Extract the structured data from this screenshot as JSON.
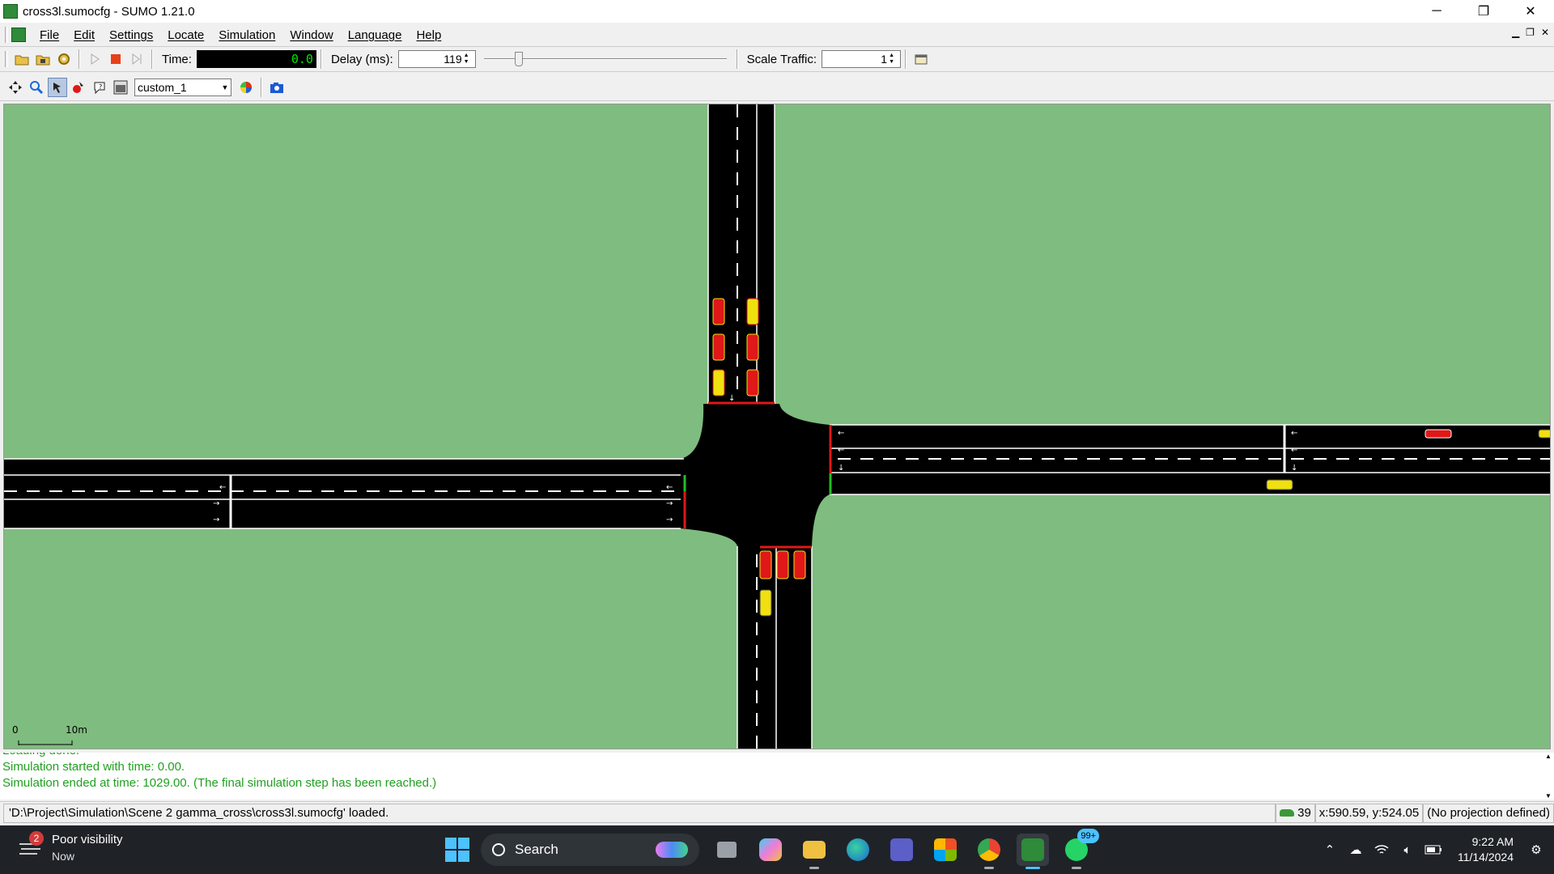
{
  "window": {
    "title": "cross3l.sumocfg - SUMO 1.21.0",
    "controls": [
      "─",
      "❐",
      "✕"
    ]
  },
  "menu": {
    "items": [
      "File",
      "Edit",
      "Settings",
      "Locate",
      "Simulation",
      "Window",
      "Language",
      "Help"
    ]
  },
  "toolbar": {
    "time_label": "Time:",
    "time_value": "0.0",
    "delay_label": "Delay (ms):",
    "delay_value": "119",
    "scale_label": "Scale Traffic:",
    "scale_value": "1"
  },
  "view_toolbar": {
    "scheme": "custom_1"
  },
  "canvas": {
    "scale_bar_start": "0",
    "scale_bar_end": "10m"
  },
  "messages": {
    "lines": [
      "Loading done.",
      "Simulation started with time: 0.00.",
      "Simulation ended at time: 1029.00. (The final simulation step has been reached.)"
    ]
  },
  "status": {
    "text": "'D:\\Project\\Simulation\\Scene 2 gamma_cross\\cross3l.sumocfg' loaded.",
    "vehicle_count": "39",
    "coords": "x:590.59, y:524.05",
    "projection": "(No projection defined)"
  },
  "taskbar": {
    "weather_badge": "2",
    "weather_title": "Poor visibility",
    "weather_sub": "Now",
    "search_label": "Search",
    "whatsapp_badge": "99+",
    "time": "9:22 AM",
    "date": "11/14/2024"
  },
  "colors": {
    "grass": "#7fbc7f",
    "road": "#000000",
    "vehicle_red": "#e01818",
    "vehicle_yellow": "#f0e010",
    "signal_red": "#e01818",
    "signal_green": "#20c020",
    "message_green": "#20a020"
  }
}
